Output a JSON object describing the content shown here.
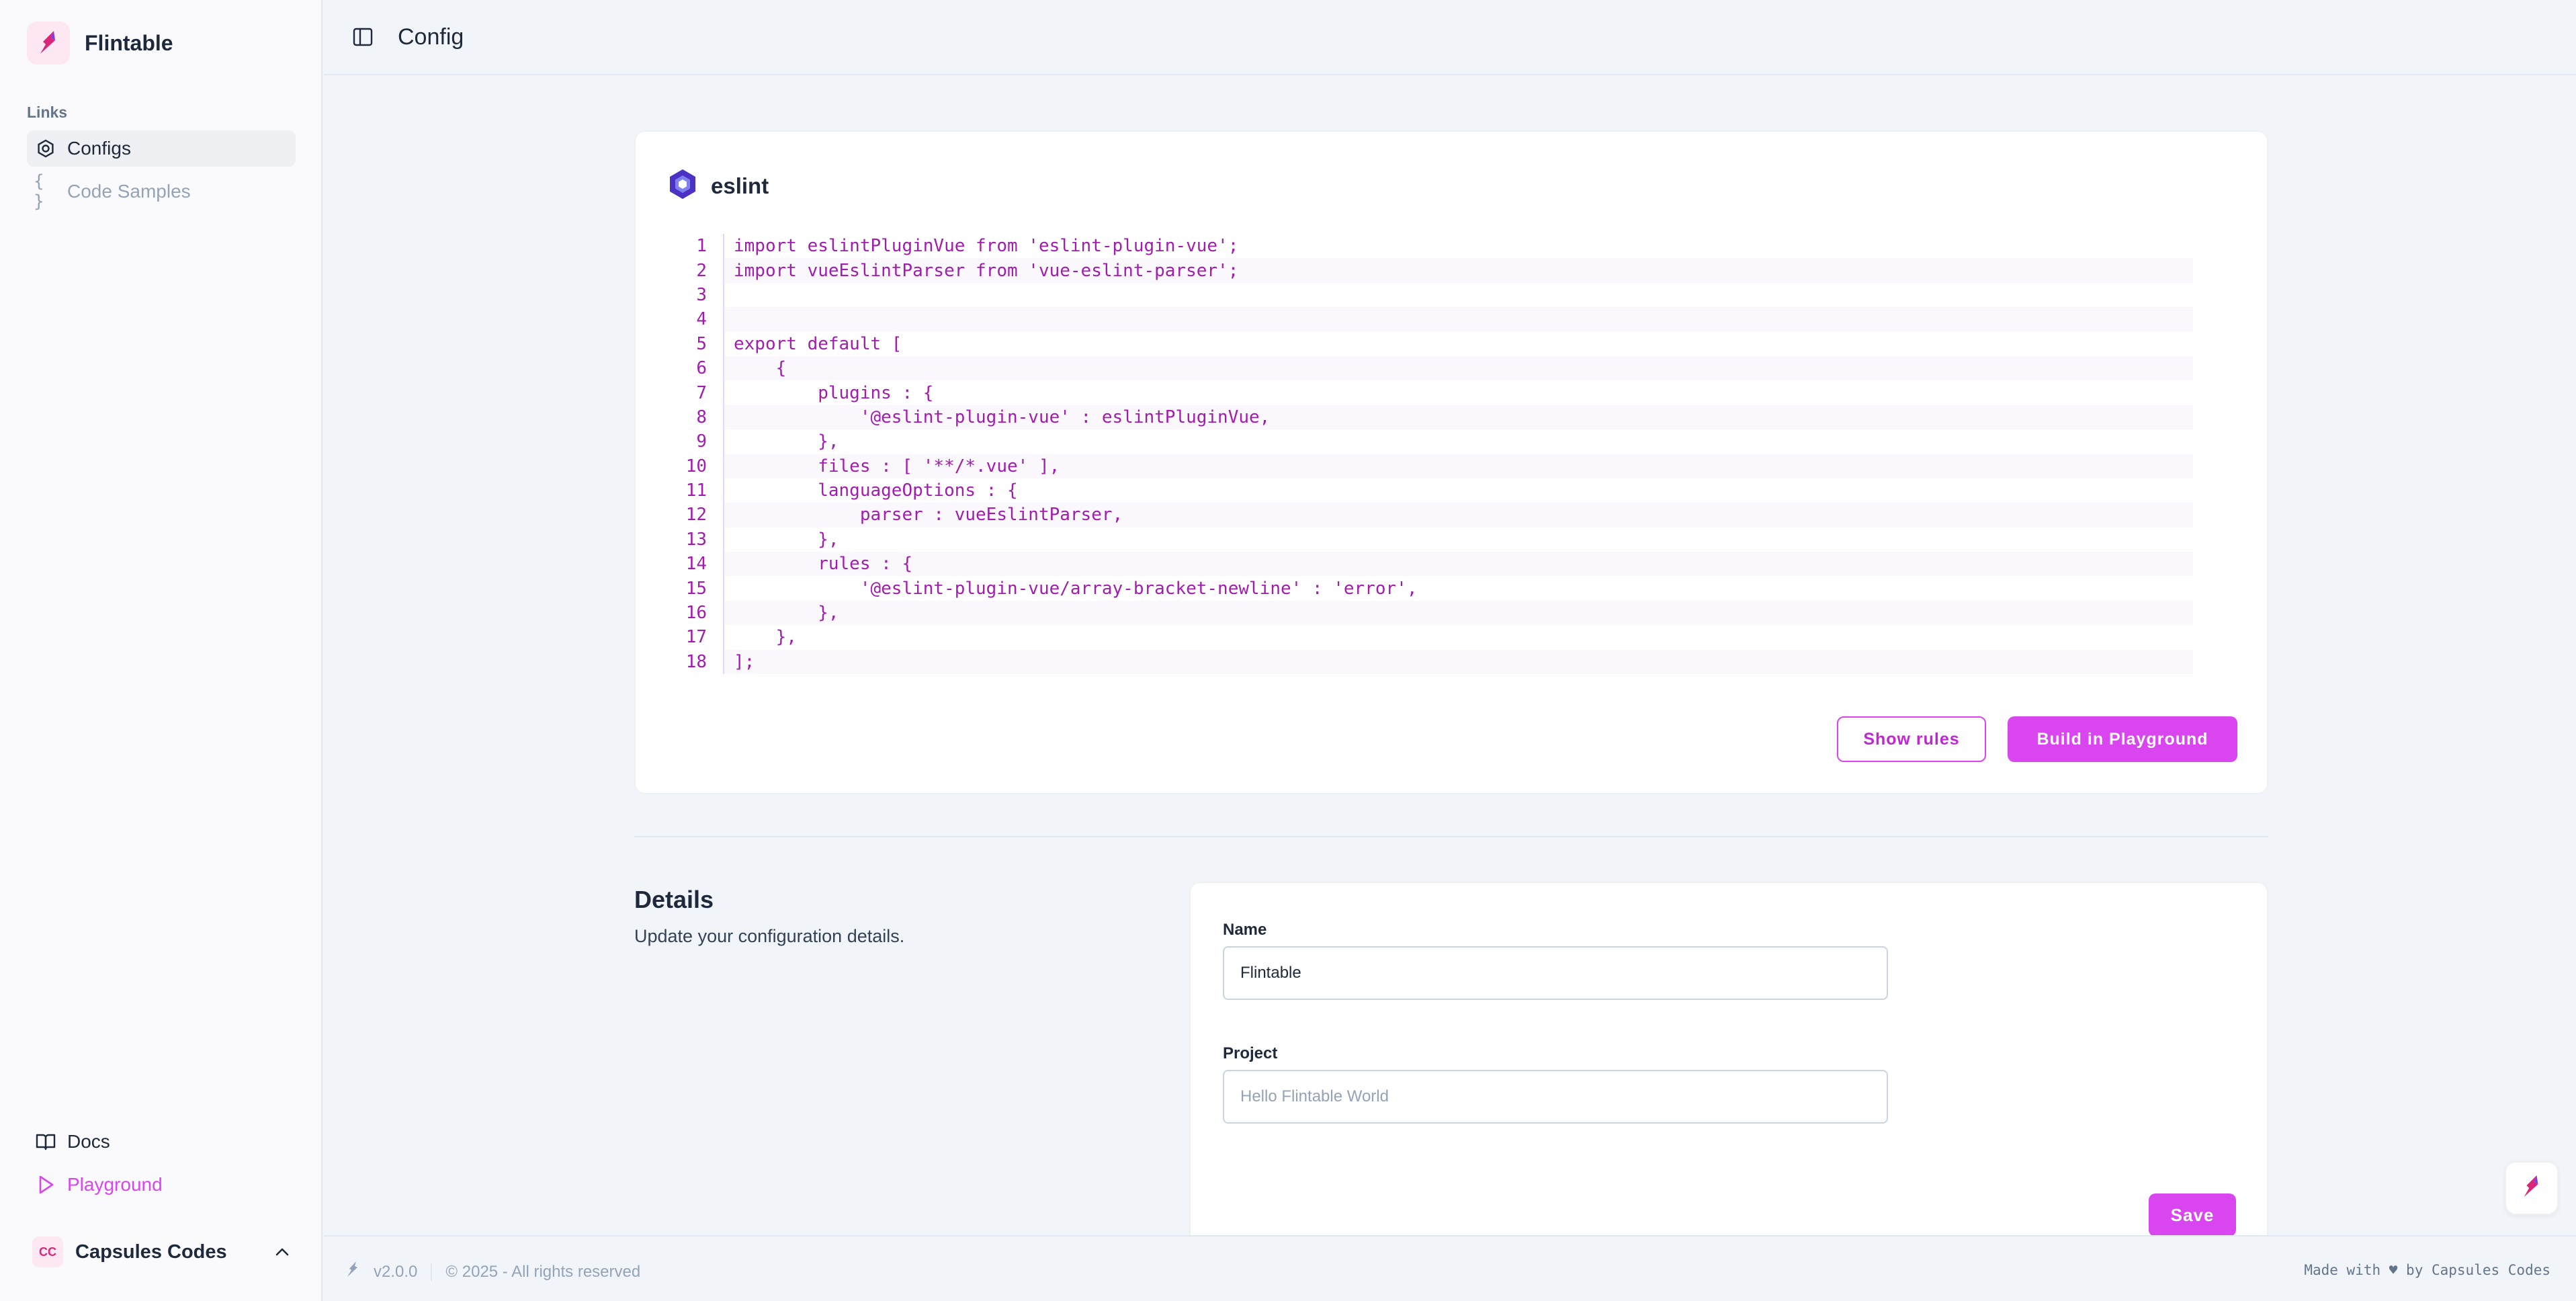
{
  "app": {
    "name": "Flintable"
  },
  "sidebar": {
    "links_label": "Links",
    "items": [
      {
        "label": "Configs",
        "icon": "hexagon-icon",
        "active": true
      },
      {
        "label": "Code Samples",
        "icon": "braces-icon",
        "active": false
      }
    ],
    "bottom_items": [
      {
        "label": "Docs",
        "icon": "book-icon"
      },
      {
        "label": "Playground",
        "icon": "play-icon"
      }
    ],
    "user": {
      "initials": "CC",
      "name": "Capsules Codes"
    }
  },
  "header": {
    "title": "Config"
  },
  "config_card": {
    "title": "eslint",
    "code_lines": [
      "import eslintPluginVue from 'eslint-plugin-vue';",
      "import vueEslintParser from 'vue-eslint-parser';",
      "",
      "",
      "export default [",
      "    {",
      "        plugins : {",
      "            '@eslint-plugin-vue' : eslintPluginVue,",
      "        },",
      "        files : [ '**/*.vue' ],",
      "        languageOptions : {",
      "            parser : vueEslintParser,",
      "        },",
      "        rules : {",
      "            '@eslint-plugin-vue/array-bracket-newline' : 'error',",
      "        },",
      "    },",
      "];"
    ],
    "show_rules_label": "Show rules",
    "build_label": "Build in Playground"
  },
  "details": {
    "title": "Details",
    "subtitle": "Update your configuration details.",
    "name_label": "Name",
    "name_value": "Flintable",
    "project_label": "Project",
    "project_placeholder": "Hello Flintable World",
    "save_label": "Save"
  },
  "footer": {
    "version": "v2.0.0",
    "copyright": "© 2025 - All rights reserved",
    "made_with": "Made with ♥ by Capsules Codes"
  },
  "colors": {
    "accent": "#d946ef",
    "code": "#a21caf",
    "brand_bg": "#fce7f3",
    "eslint": "#4b32c3"
  }
}
